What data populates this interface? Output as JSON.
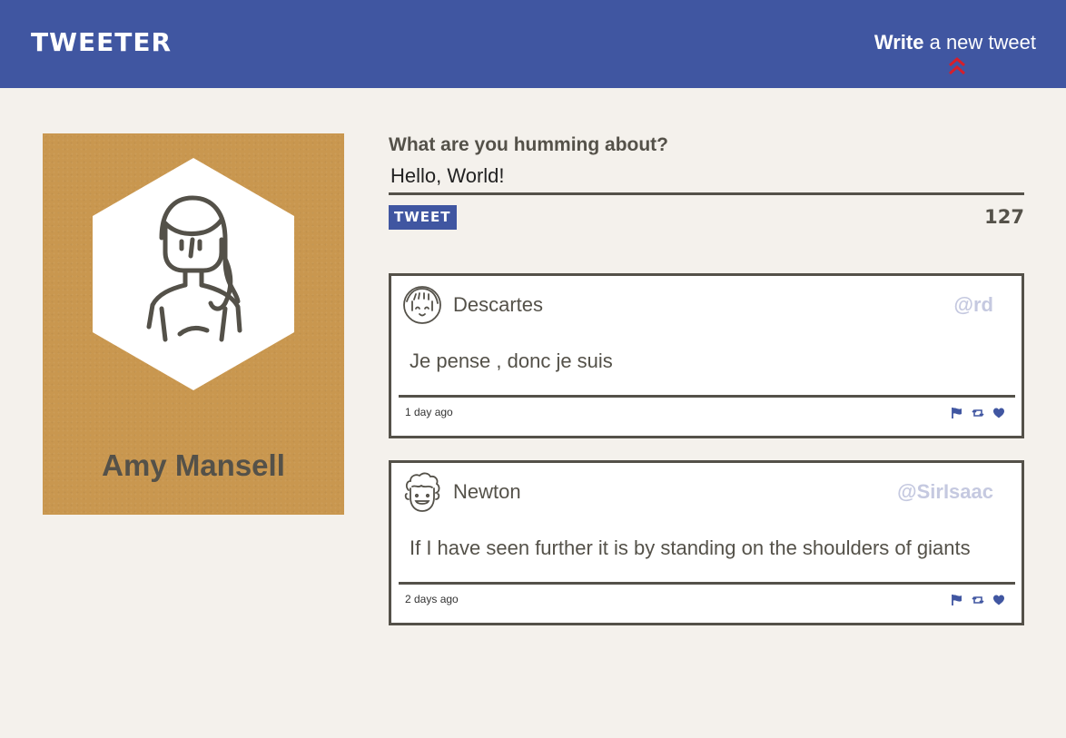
{
  "nav": {
    "logo": "TWEETER",
    "compose_strong": "Write",
    "compose_rest": "a new tweet",
    "compose_icon": "double-chevron-up-icon"
  },
  "profile": {
    "name": "Amy Mansell",
    "avatar_icon": "woman-avatar-icon"
  },
  "composer": {
    "label": "What are you humming about?",
    "value": "Hello, World!",
    "button_label": "TWEET",
    "counter": "127"
  },
  "tweets": [
    {
      "name": "Descartes",
      "handle": "@rd",
      "text": "Je pense , donc je suis",
      "time": "1 day ago",
      "avatar_icon": "girl-avatar-icon"
    },
    {
      "name": "Newton",
      "handle": "@SirIsaac",
      "text": "If I have seen further it is by standing on the shoulders of giants",
      "time": "2 days ago",
      "avatar_icon": "curly-hair-avatar-icon"
    }
  ],
  "colors": {
    "brand": "#4056a1",
    "background": "#f4f1ec",
    "text": "#545149",
    "profile_card": "#c9974f",
    "chevron": "#d71e2a",
    "handle": "#c5c9e0"
  },
  "action_icons": [
    "flag-icon",
    "retweet-icon",
    "heart-icon"
  ]
}
